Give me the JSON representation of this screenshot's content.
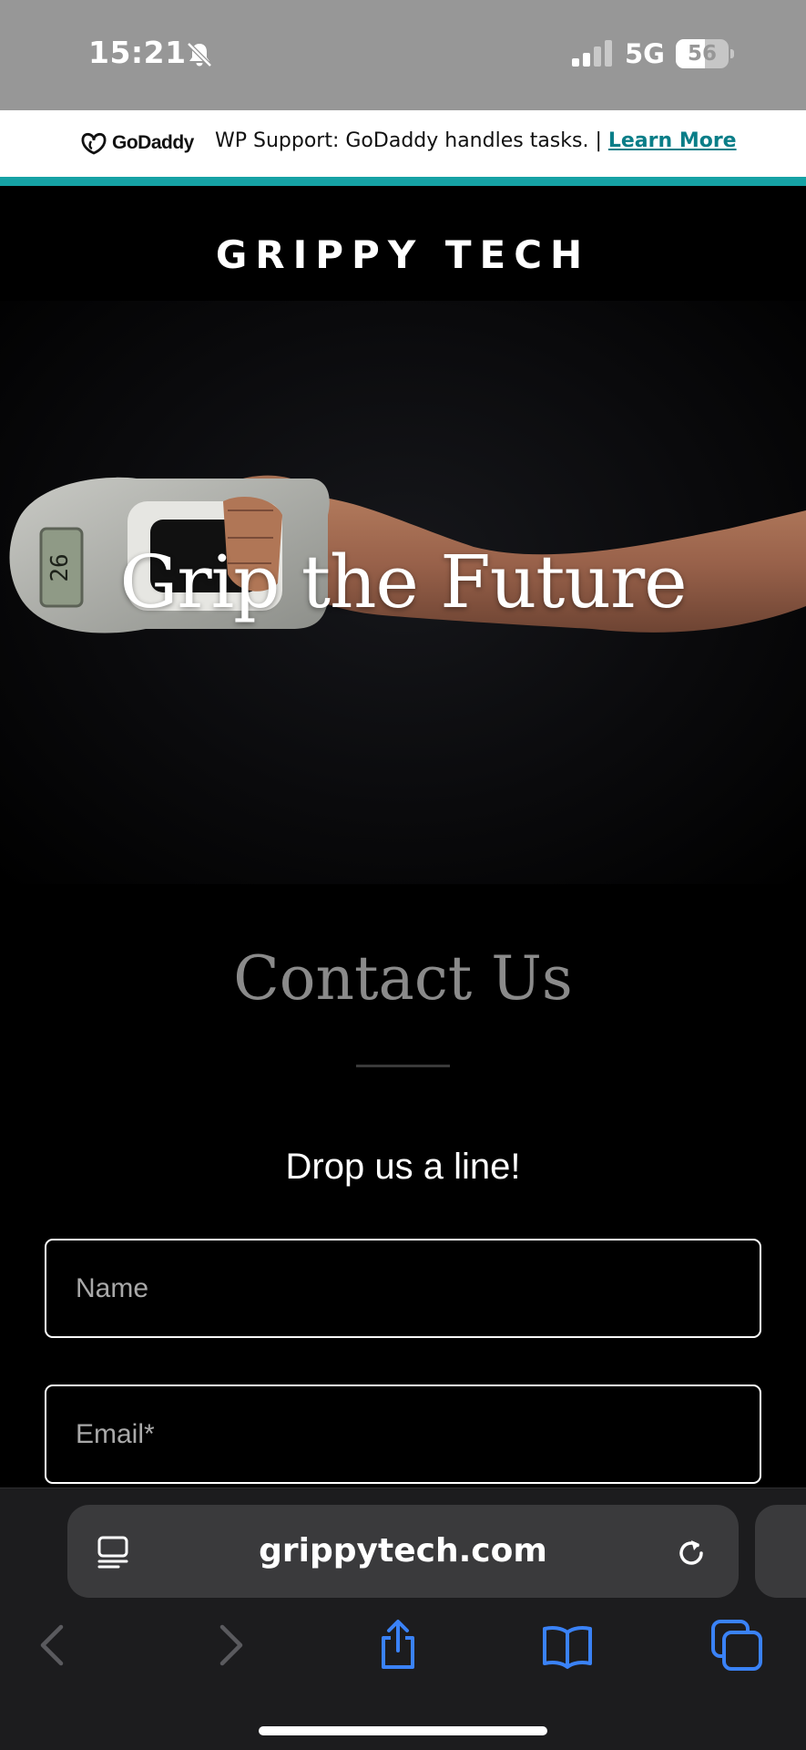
{
  "status_bar": {
    "time": "15:21",
    "network": "5G",
    "battery_percent": "56",
    "battery_level": 0.56,
    "icons": [
      "bell-slash-icon",
      "cellular-signal-icon",
      "battery-icon"
    ]
  },
  "banner": {
    "logo_text": "GoDaddy",
    "text": "WP Support: GoDaddy handles tasks. | ",
    "link_label": "Learn More",
    "accent_color": "#16a2a5",
    "link_color": "#0a7e88"
  },
  "site": {
    "brand": "GRIPPY TECH"
  },
  "hero": {
    "title": "Grip the Future",
    "device_display": "26"
  },
  "contact": {
    "title": "Contact Us",
    "subtitle": "Drop us a line!",
    "name_placeholder": "Name",
    "email_placeholder": "Email*"
  },
  "browser": {
    "url": "grippytech.com",
    "accent_color": "#3a82f7",
    "toolbar_icons": [
      "back-icon",
      "forward-icon",
      "share-icon",
      "bookmarks-icon",
      "tabs-icon"
    ]
  }
}
